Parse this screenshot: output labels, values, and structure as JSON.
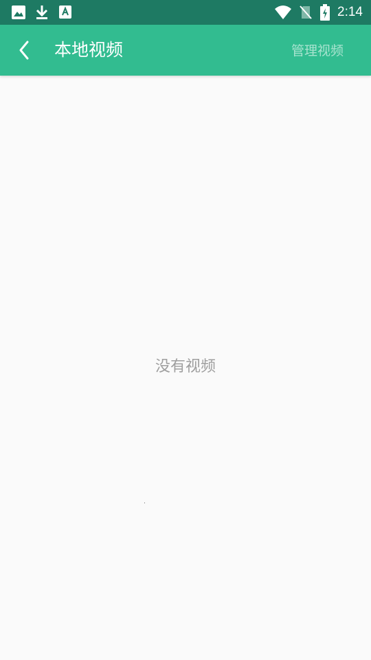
{
  "status_bar": {
    "time": "2:14",
    "left_icons": [
      "image-icon",
      "download-icon",
      "font-icon"
    ],
    "right_icons": [
      "wifi-icon",
      "no-sim-icon",
      "battery-charging-icon"
    ],
    "background": "#1e7a63"
  },
  "app_bar": {
    "back_icon": "chevron-left-icon",
    "title": "本地视频",
    "action_label": "管理视频",
    "background": "#32bc90",
    "action_color": "#a8e3cf"
  },
  "content": {
    "empty_message": "没有视频",
    "background": "#fafafa"
  }
}
